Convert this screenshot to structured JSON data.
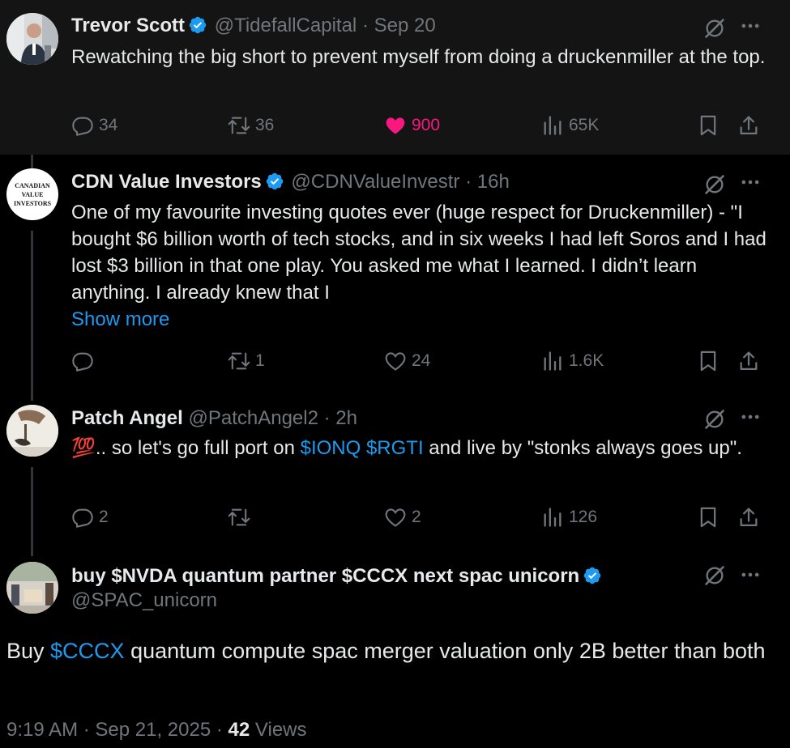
{
  "tweets": [
    {
      "name": "Trevor Scott",
      "handle": "@TidefallCapital",
      "sep": "·",
      "time": "Sep 20",
      "text": "Rewatching the big short to prevent myself from doing a druckenmiller at the top.",
      "replies": "34",
      "reposts": "36",
      "likes": "900",
      "views": "65K"
    },
    {
      "name": "CDN Value Investors",
      "handle": "@CDNValueInvestr",
      "sep": "·",
      "time": "16h",
      "text": "One of my favourite investing quotes ever (huge respect for Druckenmiller) - \"I bought $6 billion worth of tech stocks, and in six weeks I had left  Soros and I had lost $3 billion in that one play. You asked me what I  learned. I didn’t learn anything. I already knew that I",
      "show_more": "Show more",
      "avatar_text": [
        "CANADIAN",
        "VALUE",
        "INVESTORS"
      ],
      "replies": "",
      "reposts": "1",
      "likes": "24",
      "views": "1.6K"
    },
    {
      "name": "Patch Angel",
      "handle": "@PatchAngel2",
      "sep": "·",
      "time": "2h",
      "emoji": "💯",
      "text_pre": ".. so let's go full port on ",
      "tickers": "$IONQ $RGTI",
      "text_post": " and live by  \"stonks always goes up\".",
      "replies": "2",
      "reposts": "",
      "likes": "2",
      "views": "126"
    },
    {
      "name": "buy $NVDA quantum partner $CCCX next spac unicorn",
      "handle": "@SPAC_unicorn",
      "text_pre": "Buy ",
      "ticker": "$CCCX",
      "text_post": " quantum compute spac merger valuation only 2B better than both"
    }
  ],
  "footer": {
    "time": "9:19 AM",
    "sep1": "·",
    "date": "Sep 21, 2025",
    "sep2": "·",
    "views_count": "42",
    "views_label": "Views"
  },
  "colors": {
    "background": "#000000",
    "highlight_background": "#141414",
    "text": "#e7e9ea",
    "muted": "#71767b",
    "link": "#1d9bf0",
    "like": "#f91880",
    "verified": "#1d9bf0"
  },
  "icons": [
    "verified-badge-icon",
    "grok-icon",
    "more-icon",
    "reply-icon",
    "repost-icon",
    "like-icon",
    "views-icon",
    "bookmark-icon",
    "share-icon"
  ]
}
